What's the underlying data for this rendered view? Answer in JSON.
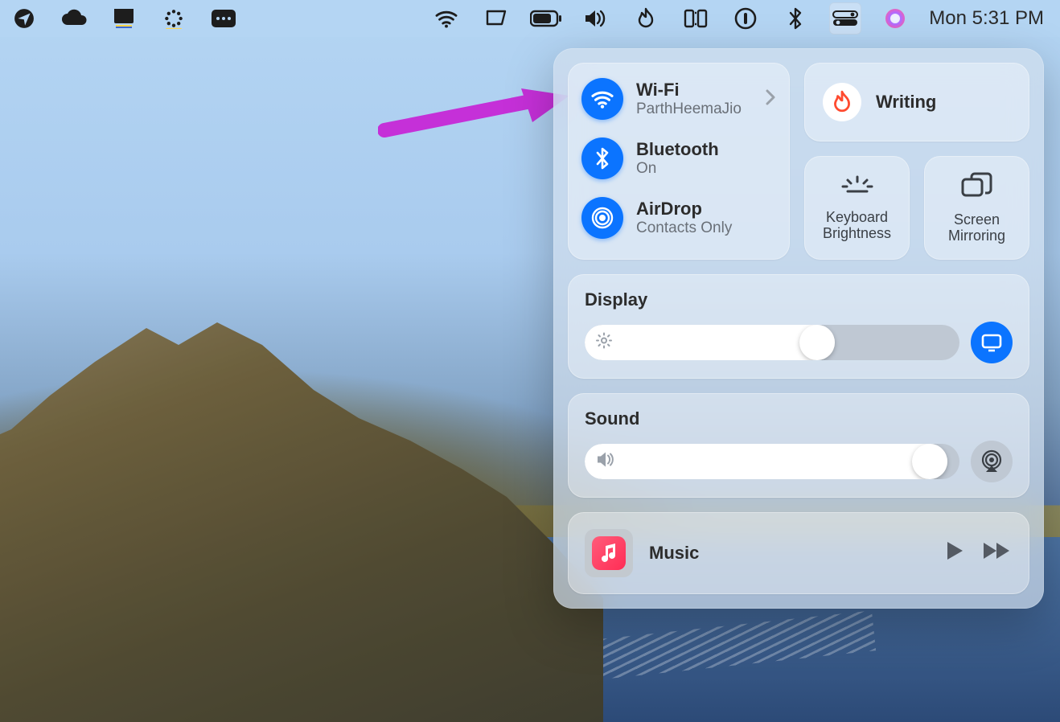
{
  "menubar": {
    "clock": "Mon 5:31 PM"
  },
  "control_center": {
    "connectivity": {
      "wifi": {
        "title": "Wi-Fi",
        "subtitle": "ParthHeemaJio"
      },
      "bluetooth": {
        "title": "Bluetooth",
        "subtitle": "On"
      },
      "airdrop": {
        "title": "AirDrop",
        "subtitle": "Contacts Only"
      }
    },
    "focus": {
      "label": "Writing"
    },
    "small": {
      "keyboard_brightness": "Keyboard Brightness",
      "screen_mirroring": "Screen Mirroring"
    },
    "display": {
      "title": "Display",
      "value_pct": 62
    },
    "sound": {
      "title": "Sound",
      "value_pct": 92
    },
    "now_playing": {
      "app": "Music",
      "title": "Music"
    }
  },
  "colors": {
    "accent": "#0b74ff",
    "arrow": "#c530d8"
  }
}
